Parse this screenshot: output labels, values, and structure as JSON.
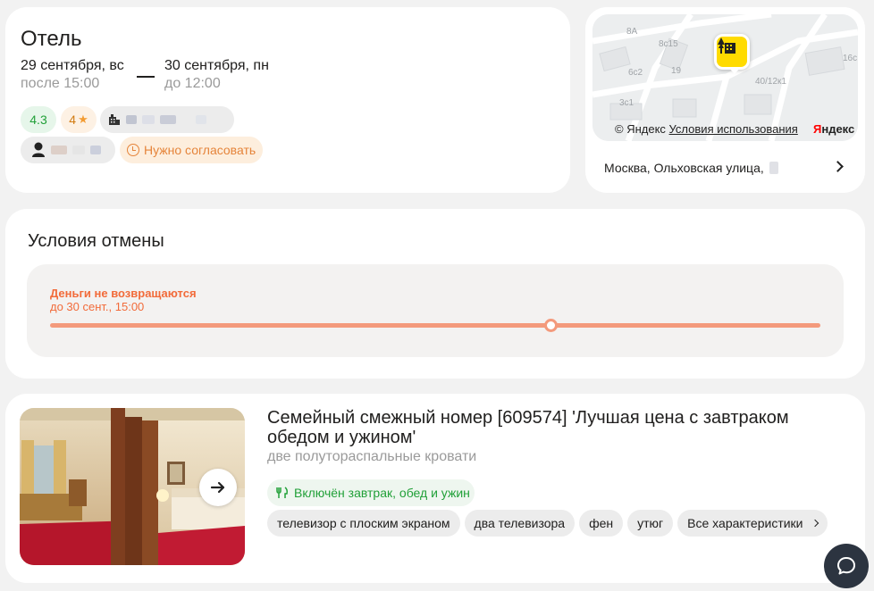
{
  "hotel": {
    "title": "Отель",
    "checkin_date": "29 сентября, вс",
    "checkin_time": "после 15:00",
    "checkout_date": "30 сентября, пн",
    "checkout_time": "до 12:00",
    "rating": "4.3",
    "stars": "4",
    "approval_label": "Нужно согласовать"
  },
  "map": {
    "labels": [
      "8A",
      "8c15",
      "6c2",
      "19",
      "16c",
      "3c1",
      "40/12к1"
    ],
    "attribution_prefix": "© Яндекс",
    "terms_link": "Условия использования",
    "logo_main": "Я",
    "logo_rest": "ндекс",
    "address": "Москва, Ольховская улица,"
  },
  "cancellation": {
    "title": "Условия отмены",
    "policy_label": "Деньги не возвращаются",
    "policy_until": "до 30 сент., 15:00"
  },
  "room": {
    "title": "Семейный смежный номер [609574] 'Лучшая цена с завтраком обедом и ужином'",
    "beds": "две полутораспальные кровати",
    "meals": "Включён завтрак, обед и ужин",
    "features": [
      "телевизор с плоским экраном",
      "два телевизора",
      "фен",
      "утюг"
    ],
    "all_features": "Все характеристики"
  },
  "colors": {
    "accent_orange": "#f26b3a",
    "timeline": "#f39a7c",
    "rating_green": "#21a038",
    "map_pin": "#ffdb00"
  }
}
